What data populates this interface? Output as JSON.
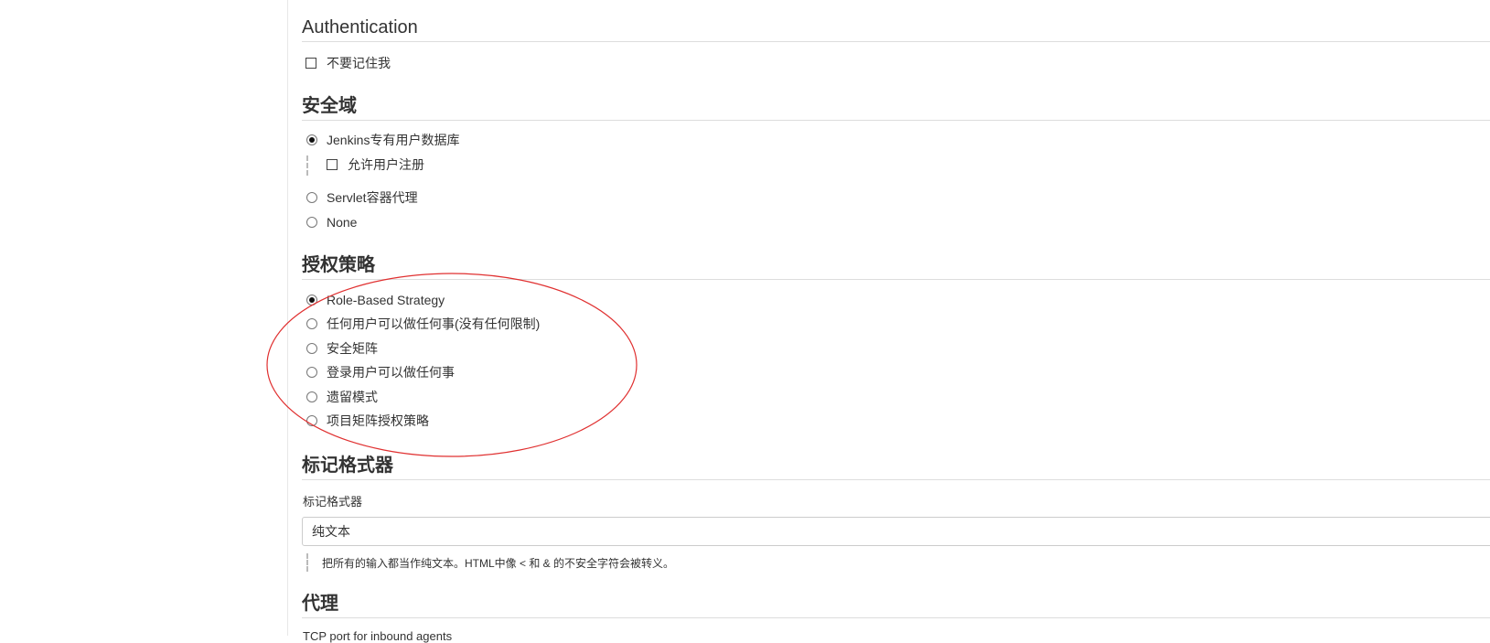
{
  "sections": {
    "authentication": {
      "title": "Authentication",
      "remember_me_label": "不要记住我"
    },
    "security_realm": {
      "title": "安全域",
      "options": [
        {
          "label": "Jenkins专有用户数据库",
          "selected": true
        },
        {
          "label": "Servlet容器代理",
          "selected": false
        },
        {
          "label": "None",
          "selected": false
        }
      ],
      "allow_signup_label": "允许用户注册"
    },
    "authorization": {
      "title": "授权策略",
      "options": [
        {
          "label": "Role-Based Strategy",
          "selected": true
        },
        {
          "label": "任何用户可以做任何事(没有任何限制)",
          "selected": false
        },
        {
          "label": "安全矩阵",
          "selected": false
        },
        {
          "label": "登录用户可以做任何事",
          "selected": false
        },
        {
          "label": "遗留模式",
          "selected": false
        },
        {
          "label": "项目矩阵授权策略",
          "selected": false
        }
      ]
    },
    "markup_formatter": {
      "title": "标记格式器",
      "field_label": "标记格式器",
      "selected_value": "纯文本",
      "help": "把所有的输入都当作纯文本。HTML中像 < 和 & 的不安全字符会被转义。"
    },
    "proxy": {
      "title": "代理",
      "partial_label": "TCP port for inbound agents"
    }
  },
  "colors": {
    "annotation": "#e03030",
    "divider": "#dddddd"
  }
}
